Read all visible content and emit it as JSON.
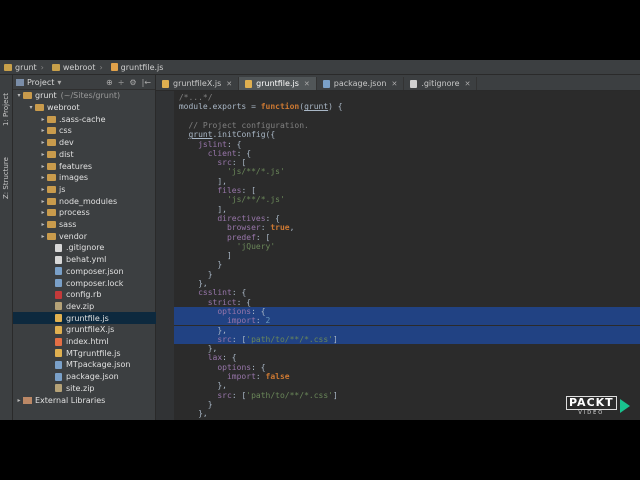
{
  "breadcrumb": [
    "grunt",
    "webroot",
    "gruntfile.js"
  ],
  "left_strip": {
    "project_tab": "1: Project",
    "structure_tab": "Z: Structure"
  },
  "project_panel": {
    "title": "Project",
    "tools": [
      "⊕",
      "÷",
      "⚙",
      "|←"
    ],
    "root": {
      "name": "grunt",
      "path": "(~/Sites/grunt)"
    },
    "webroot": "webroot",
    "folders": [
      ".sass-cache",
      "css",
      "dev",
      "dist",
      "features",
      "images",
      "js",
      "node_modules",
      "process",
      "sass",
      "vendor"
    ],
    "files": [
      {
        "name": ".gitignore",
        "kind": "gen"
      },
      {
        "name": "behat.yml",
        "kind": "gen"
      },
      {
        "name": "composer.json",
        "kind": "json"
      },
      {
        "name": "composer.lock",
        "kind": "json"
      },
      {
        "name": "config.rb",
        "kind": "rb"
      },
      {
        "name": "dev.zip",
        "kind": "zip"
      },
      {
        "name": "gruntfile.js",
        "kind": "js",
        "selected": true
      },
      {
        "name": "gruntfileX.js",
        "kind": "js"
      },
      {
        "name": "index.html",
        "kind": "html"
      },
      {
        "name": "MTgruntfile.js",
        "kind": "js"
      },
      {
        "name": "MTpackage.json",
        "kind": "json"
      },
      {
        "name": "package.json",
        "kind": "json"
      },
      {
        "name": "site.zip",
        "kind": "zip"
      }
    ],
    "external": "External Libraries"
  },
  "tabs": [
    {
      "label": "gruntfileX.js",
      "kind": "js",
      "active": false
    },
    {
      "label": "gruntfile.js",
      "kind": "js",
      "active": true
    },
    {
      "label": "package.json",
      "kind": "json",
      "active": false
    },
    {
      "label": ".gitignore",
      "kind": "gen",
      "active": false
    }
  ],
  "code_lines": [
    "/*...*/",
    "module.exports = function(grunt) {",
    "",
    "  // Project configuration.",
    "  grunt.initConfig({",
    "    jslint: {",
    "      client: {",
    "        src: [",
    "          'js/**/*.js'",
    "        ],",
    "        files: [",
    "          'js/**/*.js'",
    "        ],",
    "        directives: {",
    "          browser: true,",
    "          predef: [",
    "            'jQuery'",
    "          ]",
    "        }",
    "      }",
    "    },",
    "    csslint: {",
    "      strict: {",
    "        options: {",
    "          import: 2",
    "        },",
    "        src: ['path/to/**/*.css']",
    "      },",
    "      lax: {",
    "        options: {",
    "          import: false",
    "        },",
    "        src: ['path/to/**/*.css']",
    "      }",
    "    },",
    "  });"
  ],
  "watermark": {
    "brand": "PACKT",
    "sub": "VIDEO"
  }
}
